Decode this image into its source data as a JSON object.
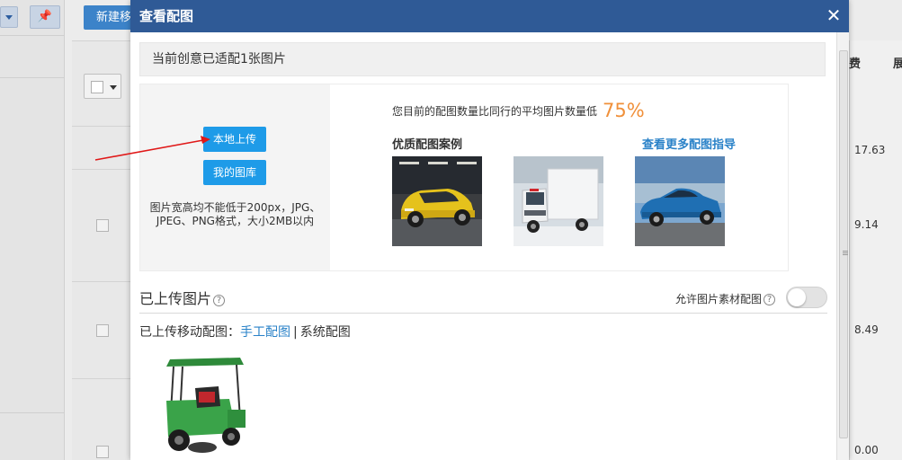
{
  "background": {
    "new_button_label": "新建移",
    "pin_icon": "pin-icon",
    "column_header_1": "费",
    "column_header_2": "展",
    "values": [
      "17.63",
      "9.14",
      "8.49",
      "0.00"
    ]
  },
  "dialog": {
    "title": "查看配图",
    "close_icon": "close-icon",
    "summary": "当前创意已适配1张图片",
    "upload_local_label": "本地上传",
    "my_gallery_label": "我的图库",
    "upload_hint": "图片宽高均不能低于200px，JPG、JPEG、PNG格式，大小2MB以内",
    "stats_text": "您目前的配图数量比同行的平均图片数量低",
    "stats_percent": "75%",
    "cases_title": "优质配图案例",
    "more_guide_link": "查看更多配图指导",
    "case_images": [
      "yellow-hatchback-car",
      "white-box-truck",
      "blue-sedan-car"
    ],
    "uploaded_title": "已上传图片",
    "allow_material_label": "允许图片素材配图",
    "allow_material_enabled": false,
    "mobile_label": "已上传移动配图：",
    "manual_link": "手工配图",
    "separator": "|",
    "system_link": "系统配图",
    "uploaded_image": "green-electric-sweeper-vehicle"
  },
  "colors": {
    "header": "#2f5a96",
    "button": "#1e9be8",
    "percent": "#f0903a",
    "link": "#2a82c8"
  }
}
